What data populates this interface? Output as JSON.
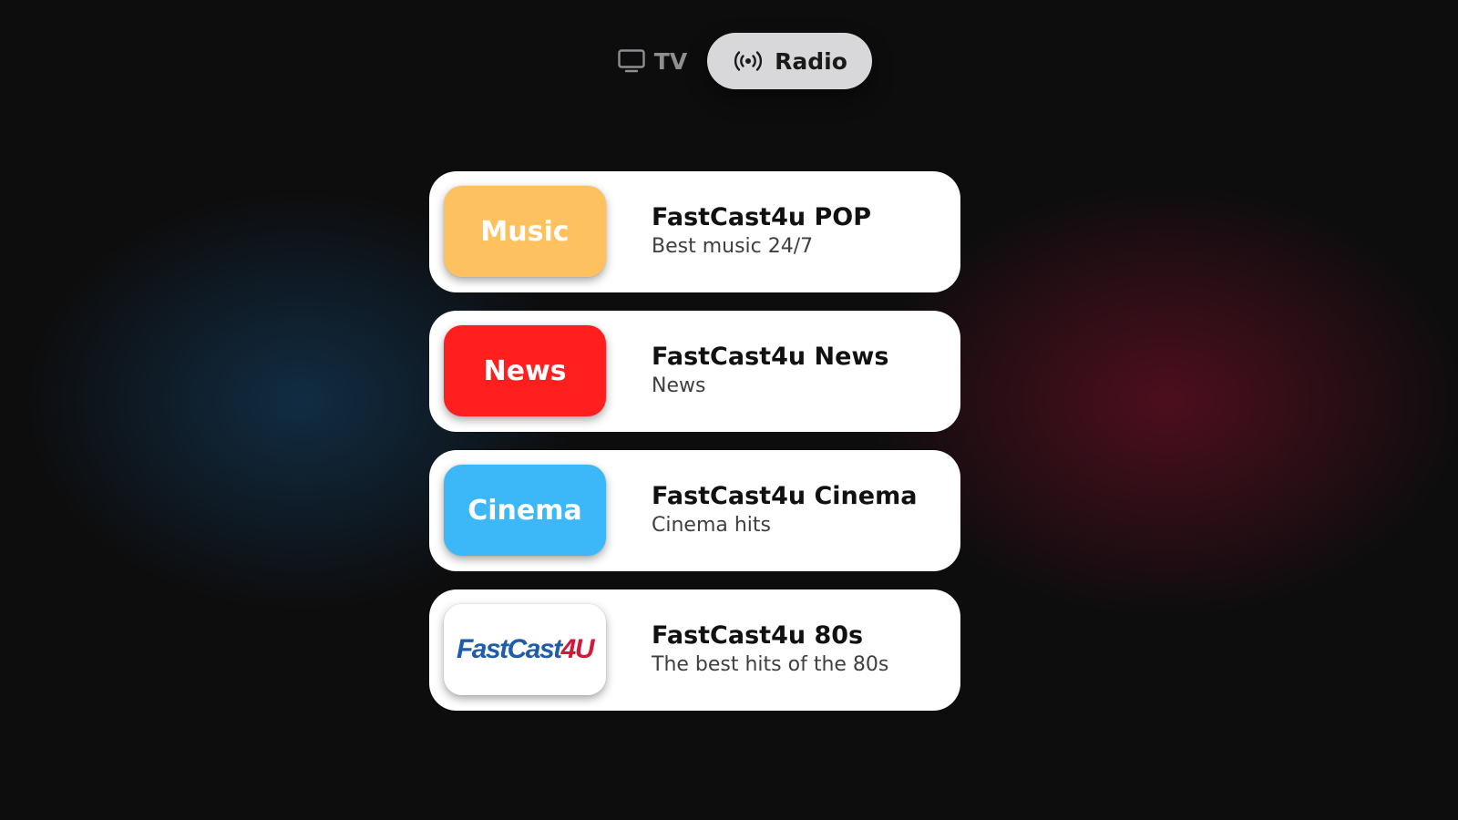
{
  "tabs": {
    "tv": {
      "label": "TV",
      "icon": "tv-icon",
      "selected": false
    },
    "radio": {
      "label": "Radio",
      "icon": "radio-broadcast-icon",
      "selected": true
    }
  },
  "channels": [
    {
      "thumb_label": "Music",
      "thumb_color": "#fec160",
      "title": "FastCast4u POP",
      "subtitle": "Best music 24/7"
    },
    {
      "thumb_label": "News",
      "thumb_color": "#ff1f1f",
      "title": "FastCast4u News",
      "subtitle": "News"
    },
    {
      "thumb_label": "Cinema",
      "thumb_color": "#3cb8f8",
      "title": "FastCast4u Cinema",
      "subtitle": "Cinema hits"
    },
    {
      "thumb_logo": {
        "part1": "FastCast",
        "part2": "4U"
      },
      "thumb_color": "#ffffff",
      "title": "FastCast4u 80s",
      "subtitle": "The best hits of the 80s"
    }
  ]
}
